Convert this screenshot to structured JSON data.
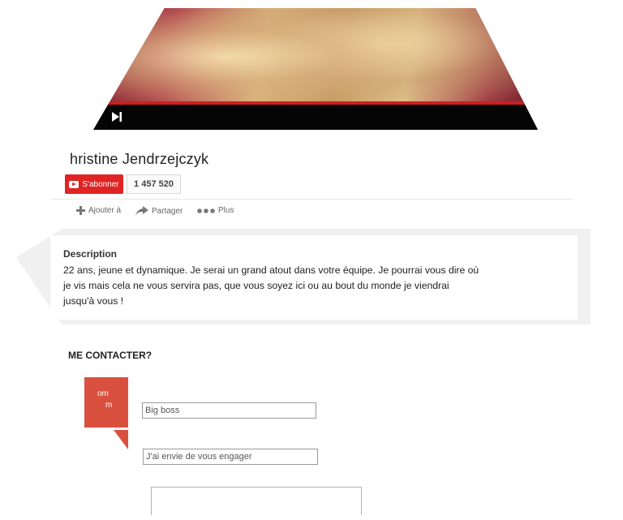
{
  "channel": {
    "name": "hristine Jendrzejczyk",
    "subscribe_label": "S'abonner",
    "subscriber_count": "1 457 520"
  },
  "actions": {
    "add_label": "Ajouter à",
    "share_label": "Partager",
    "more_label": "Plus"
  },
  "description": {
    "heading": "Description",
    "line1": "22 ans, jeune et dynamique. Je serai un grand atout dans votre équipe. Je pourrai vous dire où",
    "line2": "je vis mais cela ne vous servira pas, que vous soyez ici ou au bout du monde je viendrai",
    "line3": "jusqu'à vous !"
  },
  "contact": {
    "heading": "ME CONTACTER?",
    "label_fragment_1": "om",
    "label_fragment_2": "m",
    "field1_value": "Big boss",
    "field2_value": "J'ai envie de vous engager"
  },
  "colors": {
    "accent_red": "#e02424",
    "contact_red": "#d9503f"
  }
}
